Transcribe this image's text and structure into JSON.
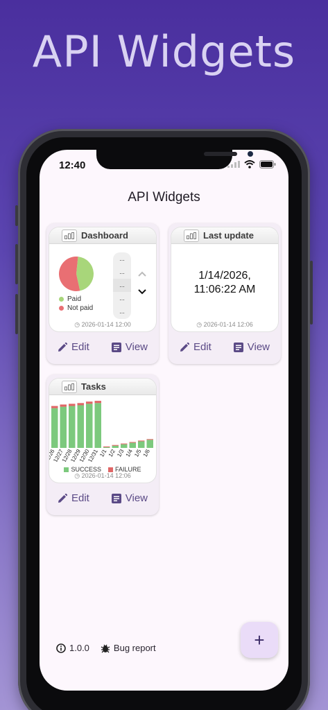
{
  "hero_title": "API Widgets",
  "status": {
    "time": "12:40"
  },
  "app": {
    "title": "API Widgets",
    "version": "1.0.0",
    "bug_report": "Bug report",
    "fab_label": "+"
  },
  "actions": {
    "edit": "Edit",
    "view": "View"
  },
  "widgets": {
    "dashboard": {
      "title": "Dashboard",
      "legend": [
        "Paid",
        "Not paid"
      ],
      "colors": {
        "paid": "#a8d67a",
        "not_paid": "#e96f73"
      },
      "timestamp": "2026-01-14 12:00",
      "list_rows": [
        "...",
        "...",
        "...",
        "...",
        "..."
      ]
    },
    "last_update": {
      "title": "Last update",
      "value_line1": "1/14/2026,",
      "value_line2": "11:06:22 AM",
      "timestamp": "2026-01-14 12:06"
    },
    "tasks": {
      "title": "Tasks",
      "timestamp": "2026-01-14 12:06",
      "legend": [
        "SUCCESS",
        "FAILURE"
      ]
    }
  },
  "chart_data": [
    {
      "type": "pie",
      "title": "",
      "categories": [
        "Paid",
        "Not paid"
      ],
      "values": [
        45,
        55
      ],
      "colors": [
        "#a8d67a",
        "#e96f73"
      ]
    },
    {
      "type": "bar",
      "title": "",
      "categories": [
        "12/26",
        "12/27",
        "12/28",
        "12/29",
        "12/30",
        "12/31",
        "1/1",
        "1/2",
        "1/3",
        "1/4",
        "1/5",
        "1/6"
      ],
      "series": [
        {
          "name": "SUCCESS",
          "values": [
            54,
            56,
            57,
            58,
            60,
            61,
            1,
            3,
            5,
            7,
            9,
            11
          ]
        },
        {
          "name": "FAILURE",
          "values": [
            3,
            3,
            3,
            3,
            3,
            3,
            1,
            1,
            1,
            1,
            1,
            1
          ]
        }
      ],
      "stacked": true,
      "colors": [
        "#7cc97d",
        "#e06666"
      ],
      "ylim": [
        0,
        66
      ]
    }
  ]
}
